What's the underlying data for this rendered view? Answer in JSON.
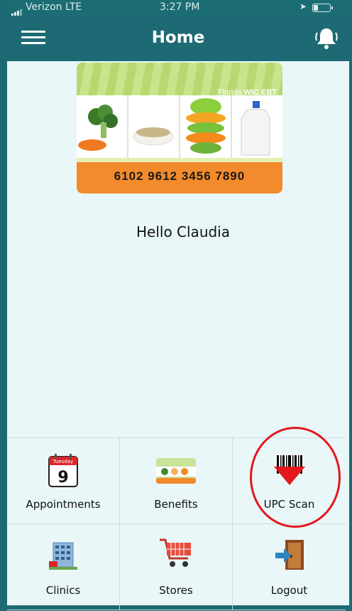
{
  "status_bar": {
    "carrier": "Verizon  LTE",
    "time": "3:27 PM"
  },
  "header": {
    "title": "Home",
    "menu_icon": "hamburger-icon",
    "notification_icon": "bell-icon"
  },
  "card": {
    "brand_prefix": "Florida",
    "brand_name": "WIC EBT",
    "number": "6102 9612 3456 7890"
  },
  "greeting": "Hello Claudia",
  "menu": [
    {
      "label": "Appointments",
      "icon": "calendar-icon",
      "calendar_day": "Tuesday",
      "calendar_date": "9"
    },
    {
      "label": "Benefits",
      "icon": "benefits-card-icon"
    },
    {
      "label": "UPC Scan",
      "icon": "barcode-scan-icon"
    },
    {
      "label": "Clinics",
      "icon": "building-icon"
    },
    {
      "label": "Stores",
      "icon": "shopping-cart-icon"
    },
    {
      "label": "Logout",
      "icon": "door-exit-icon"
    }
  ],
  "colors": {
    "header": "#1e6a74",
    "background": "#e9f7f8",
    "highlight_ring": "#e3171c",
    "card_orange": "#f38a2b"
  }
}
